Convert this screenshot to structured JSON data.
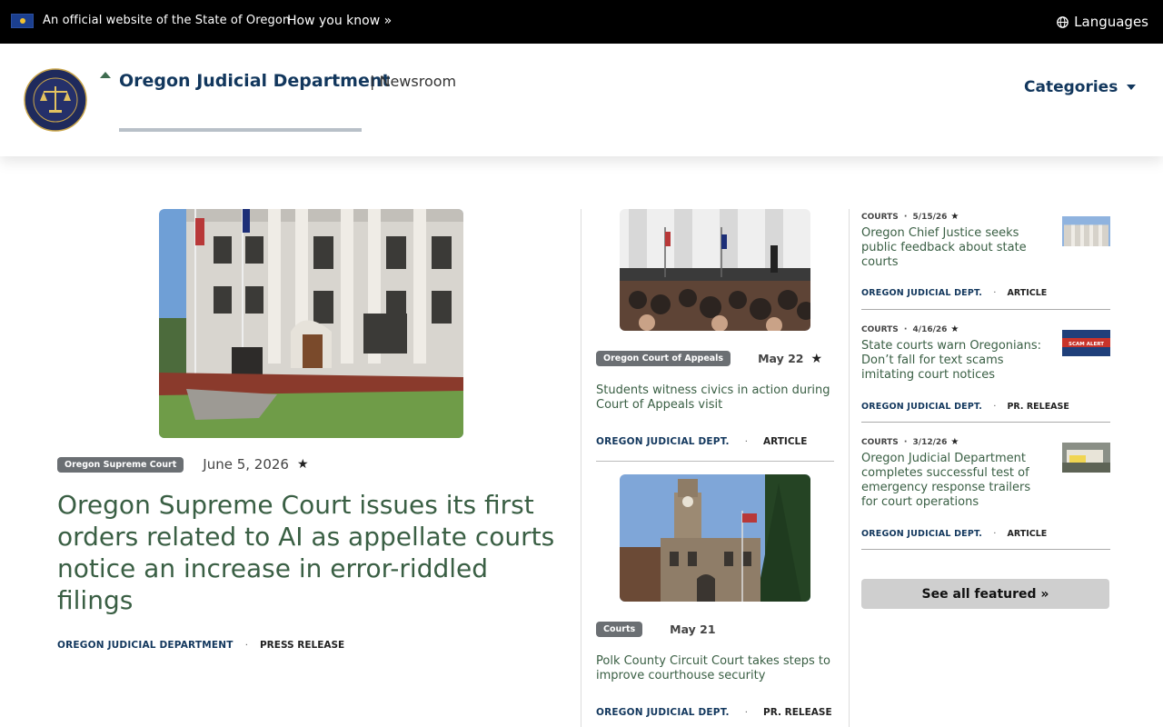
{
  "gov_bar": {
    "official_text": "An official website of the State of Oregon",
    "how_you_know": "How you know »",
    "languages": "Languages"
  },
  "header": {
    "site_name": "Oregon Judicial Department",
    "section": "| Newsroom",
    "categories": "Categories"
  },
  "featured": {
    "tag": "Oregon Supreme Court",
    "date": "June 5, 2026",
    "title": "Oregon Supreme Court issues its first orders related to AI as appellate courts notice an increase in error-riddled filings",
    "source": "OREGON JUDICIAL DEPARTMENT",
    "type": "PRESS RELEASE"
  },
  "middle": [
    {
      "tag": "Oregon Court of Appeals",
      "date": "May 22",
      "title": "Students witness civics in action during Court of Appeals visit",
      "source": "OREGON JUDICIAL DEPT.",
      "type": "ARTICLE"
    },
    {
      "tag": "Courts",
      "date": "May 21",
      "title": "Polk County Circuit Court takes steps to improve courthouse security",
      "source": "OREGON JUDICIAL DEPT.",
      "type": "PR. RELEASE"
    }
  ],
  "right": [
    {
      "category": "COURTS",
      "date": "5/15/26",
      "title": "Oregon Chief Justice seeks public feedback about state courts",
      "source": "OREGON JUDICIAL DEPT.",
      "type": "ARTICLE"
    },
    {
      "category": "COURTS",
      "date": "4/16/26",
      "title": "State courts warn Oregonians: Don’t fall for text scams imitating court notices",
      "source": "OREGON JUDICIAL DEPT.",
      "type": "PR. RELEASE",
      "thumb_text": "SCAM ALERT"
    },
    {
      "category": "COURTS",
      "date": "3/12/26",
      "title": "Oregon Judicial Department completes successful test of emergency response trailers for court operations",
      "source": "OREGON JUDICIAL DEPT.",
      "type": "ARTICLE"
    }
  ],
  "see_all": "See all featured »",
  "star_glyph": "★",
  "dot_glyph": "·"
}
